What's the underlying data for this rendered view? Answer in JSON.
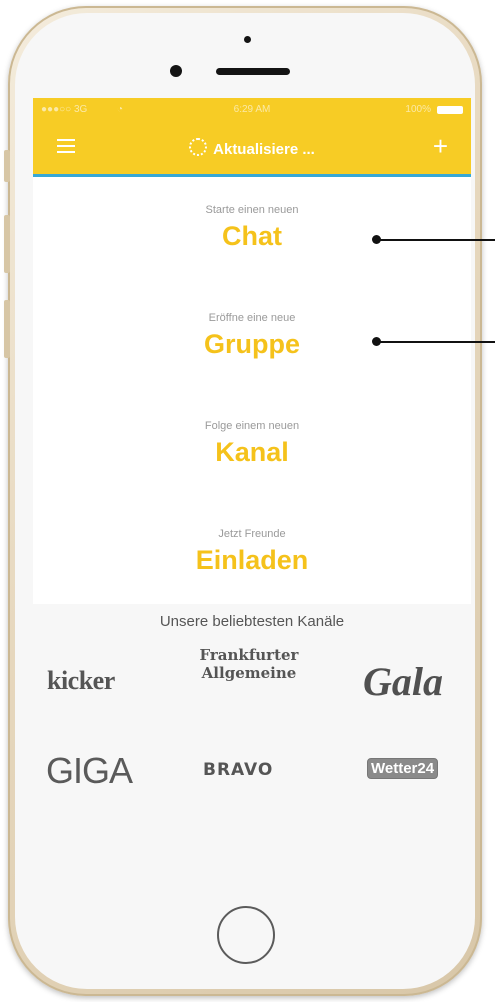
{
  "status": {
    "carrier": "●●●○○ 3G",
    "time": "6:29 AM",
    "battery": "100%"
  },
  "navbar": {
    "title": "Aktualisiere ..."
  },
  "options": [
    {
      "sub": "Starte einen neuen",
      "big": "Chat"
    },
    {
      "sub": "Eröffne eine neue",
      "big": "Gruppe"
    },
    {
      "sub": "Folge einem neuen",
      "big": "Kanal"
    },
    {
      "sub": "Jetzt Freunde",
      "big": "Einladen"
    }
  ],
  "channels": {
    "title": "Unsere beliebtesten Kanäle",
    "logos": {
      "kicker": "kicker",
      "faz_line1": "Frankfurter",
      "faz_line2": "Allgemeine",
      "gala": "Gala",
      "giga": "GIGA",
      "bravo": "BRAVO",
      "wetter": "Wetter24"
    }
  },
  "colors": {
    "accent": "#f7cc25",
    "accent_text": "#f5c21b",
    "divider_blue": "#37a8d6",
    "callout": "#111111"
  }
}
